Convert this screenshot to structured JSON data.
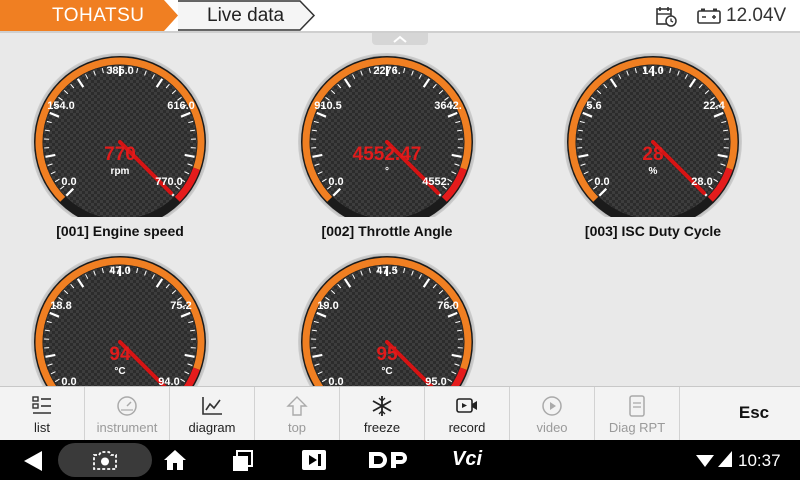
{
  "header": {
    "brand": "TOHATSU",
    "breadcrumb": "Live data",
    "voltage": "12.04V",
    "brand_color": "#f07f22"
  },
  "gauges": [
    {
      "title": "[001] Engine speed",
      "value": "770",
      "unit": "rpm",
      "tick_min": "0.0",
      "tick_low": "154.0",
      "tick_top": "385.0",
      "tick_high": "616.0",
      "tick_max": "770.0",
      "reading_fraction": 1.0
    },
    {
      "title": "[002] Throttle Angle",
      "value": "4552.47",
      "unit": "°",
      "tick_min": "0.0",
      "tick_low": "910.5",
      "tick_top": "2276.",
      "tick_high": "3642.",
      "tick_max": "4552.",
      "reading_fraction": 1.0
    },
    {
      "title": "[003] ISC Duty Cycle",
      "value": "28",
      "unit": "%",
      "tick_min": "0.0",
      "tick_low": "5.6",
      "tick_top": "14.0",
      "tick_high": "22.4",
      "tick_max": "28.0",
      "reading_fraction": 1.0
    },
    {
      "title": "",
      "value": "94",
      "unit": "°C",
      "tick_min": "0.0",
      "tick_low": "18.8",
      "tick_top": "47.0",
      "tick_high": "75.2",
      "tick_max": "94.0",
      "reading_fraction": 1.0
    },
    {
      "title": "",
      "value": "95",
      "unit": "°C",
      "tick_min": "0.0",
      "tick_low": "19.0",
      "tick_top": "47.5",
      "tick_high": "76.0",
      "tick_max": "95.0",
      "reading_fraction": 1.0
    }
  ],
  "toolbar": {
    "buttons": [
      {
        "label": "list",
        "icon": "list-icon",
        "enabled": true
      },
      {
        "label": "instrument",
        "icon": "gauge-icon",
        "enabled": false
      },
      {
        "label": "diagram",
        "icon": "chart-icon",
        "enabled": true
      },
      {
        "label": "top",
        "icon": "arrow-up-icon",
        "enabled": false
      },
      {
        "label": "freeze",
        "icon": "snowflake-icon",
        "enabled": true
      },
      {
        "label": "record",
        "icon": "video-camera-icon",
        "enabled": true
      },
      {
        "label": "video",
        "icon": "play-icon",
        "enabled": false
      },
      {
        "label": "Diag RPT",
        "icon": "document-icon",
        "enabled": false
      }
    ],
    "esc_label": "Esc"
  },
  "navbar": {
    "time": "10:37",
    "vci_label": "Vci"
  },
  "colors": {
    "gauge_value": "#e01b1b",
    "needle": "#d61414",
    "dial_orange": "#f07f22"
  }
}
